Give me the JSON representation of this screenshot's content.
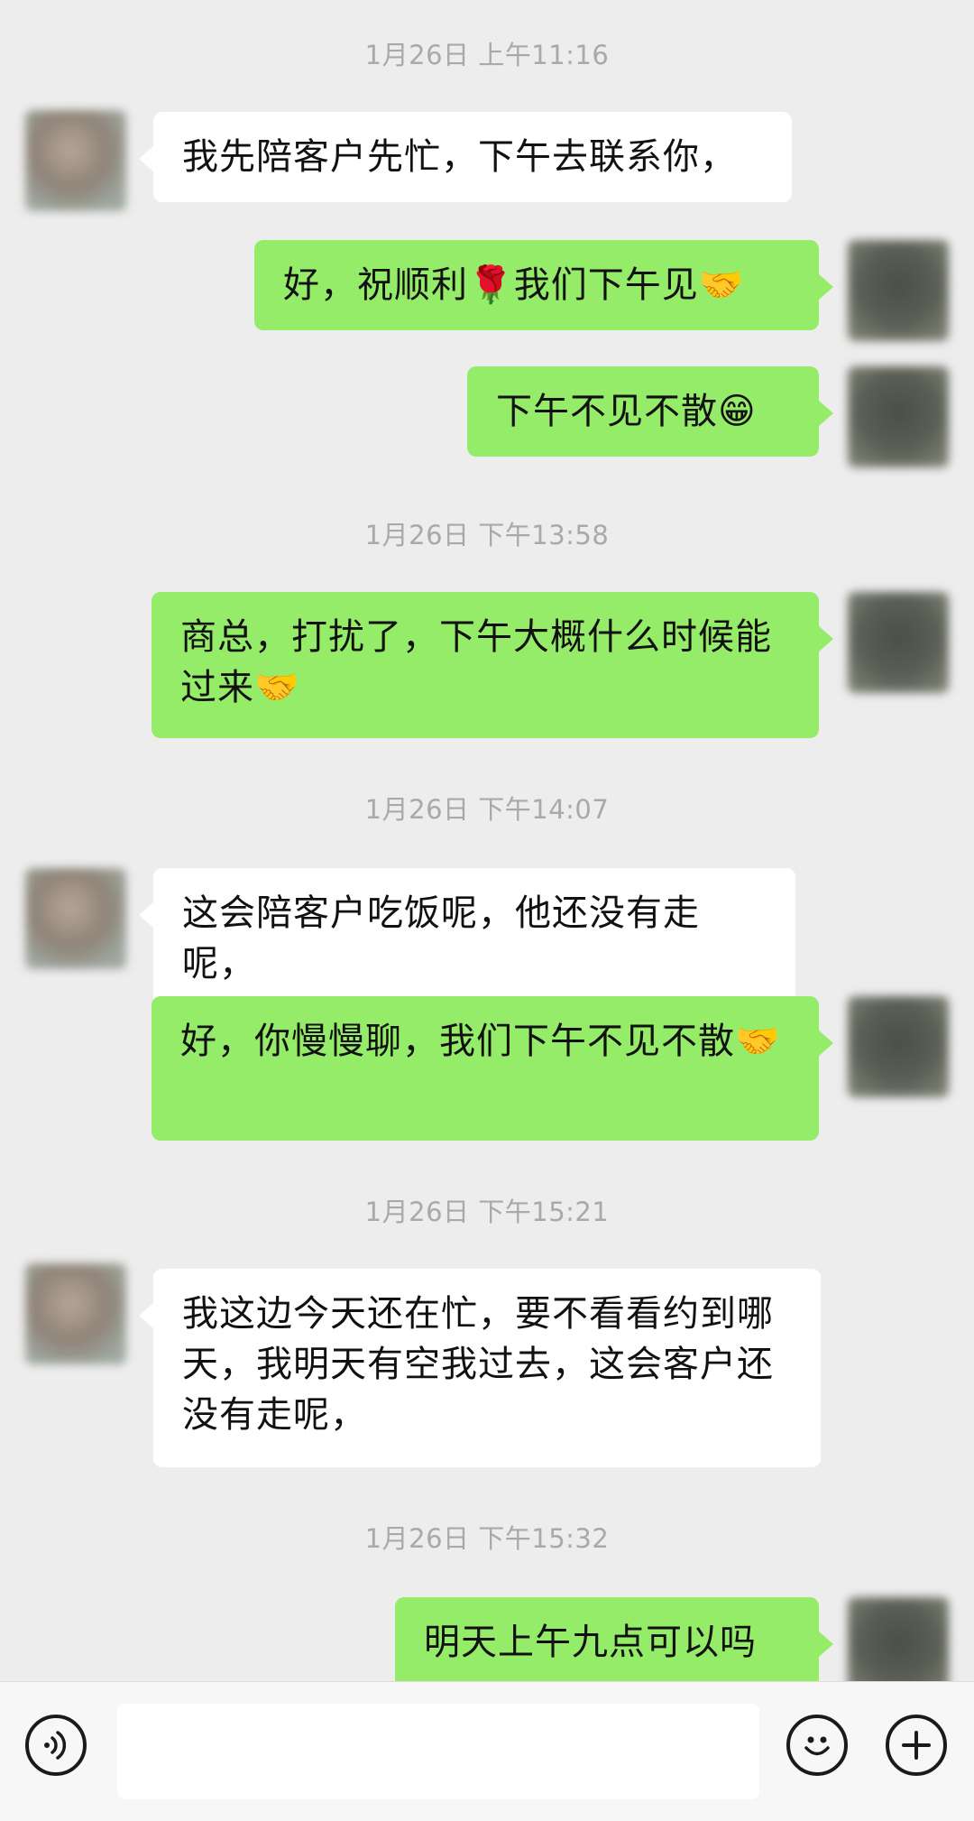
{
  "messages": [
    {
      "type": "time",
      "text": "1月26日 上午11:16"
    },
    {
      "type": "msg",
      "side": "left",
      "text": "我先陪客户先忙，下午去联系你，"
    },
    {
      "type": "msg",
      "side": "right",
      "text": "好，祝顺利🌹我们下午见🤝"
    },
    {
      "type": "msg",
      "side": "right",
      "text": "下午不见不散😁"
    },
    {
      "type": "time",
      "text": "1月26日 下午13:58"
    },
    {
      "type": "msg",
      "side": "right",
      "text": "商总，打扰了，下午大概什么时候能过来🤝"
    },
    {
      "type": "time",
      "text": "1月26日 下午14:07"
    },
    {
      "type": "msg",
      "side": "left",
      "text": "这会陪客户吃饭呢，他还没有走呢，"
    },
    {
      "type": "msg",
      "side": "right",
      "text": "好，你慢慢聊，我们下午不见不散🤝"
    },
    {
      "type": "time",
      "text": "1月26日 下午15:21"
    },
    {
      "type": "msg",
      "side": "left",
      "text": "我这边今天还在忙，要不看看约到哪天，我明天有空我过去，这会客户还没有走呢，"
    },
    {
      "type": "time",
      "text": "1月26日 下午15:32"
    },
    {
      "type": "msg",
      "side": "right",
      "text": "明天上午九点可以吗"
    }
  ],
  "input": {
    "value": ""
  },
  "icons": {
    "voice": "voice-icon",
    "emoji": "emoji-icon",
    "plus": "plus-icon"
  }
}
